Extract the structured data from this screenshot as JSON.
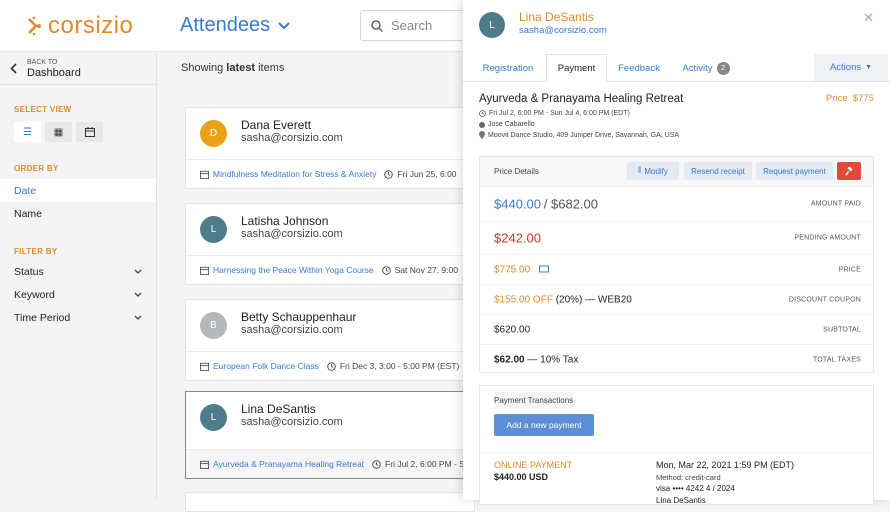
{
  "app": {
    "logo_text": "corsizio",
    "page_title": "Attendees",
    "search_placeholder": "Search"
  },
  "colors": {
    "brand": "#e08a2a",
    "accent": "#3a7bc8",
    "danger": "#e04a3a"
  },
  "sidebar": {
    "back_small": "BACK TO",
    "back_big": "Dashboard",
    "select_view_label": "SELECT VIEW",
    "order_by_label": "ORDER BY",
    "order_items": [
      {
        "label": "Date"
      },
      {
        "label": "Name"
      }
    ],
    "filter_by_label": "FILTER BY",
    "filters": [
      {
        "label": "Status"
      },
      {
        "label": "Keyword"
      },
      {
        "label": "Time Period"
      }
    ]
  },
  "list": {
    "heading_prefix": "Showing",
    "heading_bold": "latest",
    "heading_suffix": "items",
    "cards": [
      {
        "initial": "D",
        "name": "Dana Everett",
        "email": "sasha@corsizio.com",
        "event": "Mindfulness Meditation for Stress & Anxiety",
        "date": "Fri Jun 25, 6:00",
        "avatar_color": "#e8a21a"
      },
      {
        "initial": "L",
        "name": "Latisha Johnson",
        "email": "sasha@corsizio.com",
        "event": "Harnessing the Peace Within Yoga Course",
        "date": "Sat Nov 27, 9:00",
        "avatar_color": "#4e7c8a"
      },
      {
        "initial": "B",
        "name": "Betty Schauppenhaur",
        "email": "sasha@corsizio.com",
        "event": "European Folk Dance Class",
        "date": "Fri Dec 3, 3:00 - 5:00 PM (EST)",
        "avatar_color": "#b5b8bd"
      },
      {
        "initial": "L",
        "name": "Lina DeSantis",
        "email": "sasha@corsizio.com",
        "event": "Ayurveda & Pranayama Healing Retreat",
        "date": "Fri Jul 2, 6:00 PM - S",
        "avatar_color": "#4e7c8a"
      }
    ]
  },
  "panel": {
    "initial": "L",
    "name": "Lina DeSantis",
    "email": "sasha@corsizio.com",
    "tabs": [
      {
        "label": "Registration"
      },
      {
        "label": "Payment"
      },
      {
        "label": "Feedback"
      },
      {
        "label": "Activity",
        "badge": "2"
      }
    ],
    "actions_label": "Actions",
    "event_title": "Ayurveda & Pranayama Healing Retreat",
    "price_label": "Price",
    "price_value": "$775",
    "event_date": "Fri Jul 2, 6:00 PM - Sun Jul 4, 6:00 PM (EDT)",
    "event_instructor": "Jose Cabarello",
    "event_location": "Moovit Dance Studio, 409 Juniper Drive, Savannah, GA, USA",
    "price_details": {
      "title": "Price Details",
      "buttons": {
        "modify": "Modify",
        "resend": "Resend receipt",
        "request": "Request payment"
      },
      "amount_paid": "$440.00",
      "amount_total": "/ $682.00",
      "amount_paid_label": "AMOUNT PAID",
      "pending": "$242.00",
      "pending_label": "PENDING AMOUNT",
      "price": "$775.00",
      "price_row_label": "PRICE",
      "coupon_off": "$155.00 OFF",
      "coupon_detail": "(20%) — WEB20",
      "coupon_label": "DISCOUNT COUPON",
      "subtotal": "$620.00",
      "subtotal_label": "SUBTOTAL",
      "taxes_amount": "$62.00",
      "taxes_detail": "— 10% Tax",
      "taxes_label": "TOTAL TAXES"
    },
    "transactions": {
      "title": "Payment Transactions",
      "add_button": "Add a new payment",
      "type": "ONLINE PAYMENT",
      "amount": "$440.00 USD",
      "datetime": "Mon, Mar 22, 2021 1:59 PM (EDT)",
      "method": "Method: credit-card",
      "card": "visa •••• 4242   4 / 2024",
      "holder": "Lina DeSantis"
    }
  }
}
